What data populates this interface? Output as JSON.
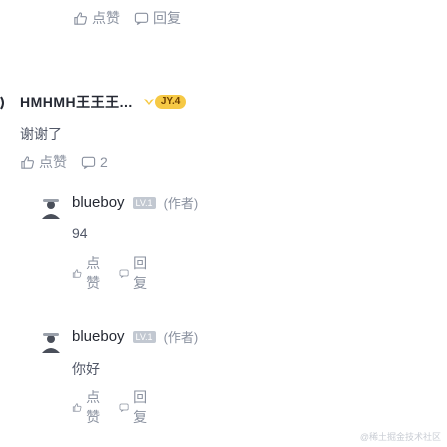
{
  "top_actions": {
    "like_label": "点赞",
    "reply_label": "回复"
  },
  "reply": {
    "author": "HMHMH王王王...",
    "badge_level": "JY.4",
    "text": "谢谢了",
    "like_label": "点赞",
    "reply_count": "2"
  },
  "comments": [
    {
      "name": "blueboy",
      "level": "LV.1",
      "role": "(作者)",
      "text": "94",
      "like_label": "点赞",
      "reply_label": "回复"
    },
    {
      "name": "blueboy",
      "level": "LV.1",
      "role": "(作者)",
      "text": "你好",
      "like_label": "点赞",
      "reply_label": "回复"
    }
  ],
  "watermark": "@稀土掘金技术社区",
  "colors": {
    "meta": "#8a919f",
    "text": "#515767",
    "name": "#252933",
    "badge": "#f6c945"
  }
}
